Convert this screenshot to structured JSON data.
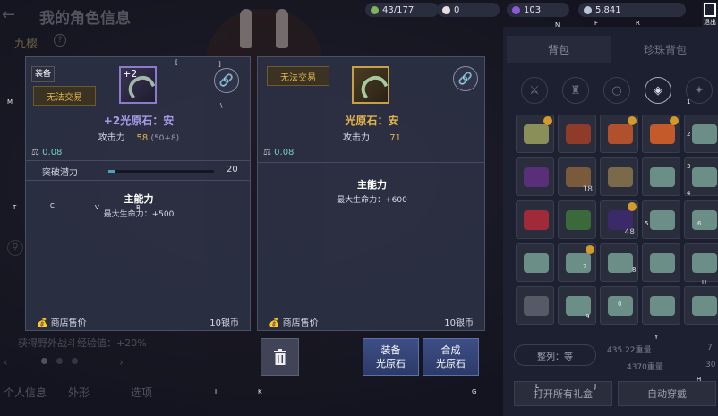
{
  "header": {
    "title": "我的角色信息",
    "char_name": "九樱"
  },
  "resources": [
    {
      "icon": "stamina-icon",
      "value": "43/177",
      "color": "#7fb25a"
    },
    {
      "icon": "pearl-icon",
      "value": "0",
      "color": "#e8dede"
    },
    {
      "icon": "gem-icon",
      "value": "103",
      "color": "#8a5cd6"
    },
    {
      "icon": "silver-coin-icon",
      "value": "5,841",
      "color": "#b9c6d8"
    }
  ],
  "exit_label": "退出",
  "left_bg": {
    "exp_text": "获得野外战斗经验值：+20%",
    "bottom_tabs": [
      "个人信息",
      "外形",
      "选项"
    ]
  },
  "inventory": {
    "tabs": [
      "背包",
      "珍珠背包"
    ],
    "sort_label": "整列：等",
    "weight1": "435.22重量",
    "weight2": "4370重量",
    "cut_value1": "7",
    "cut_value2": "30",
    "open_all_label": "打开所有礼盒",
    "auto_equip_label": "自动穿戴",
    "counts": [
      "18",
      "48"
    ]
  },
  "equipped_card": {
    "equipped_tag": "装备",
    "untradable": "无法交易",
    "enhance_level": "+2",
    "item_name": "+2光原石：安",
    "stat_label": "攻击力",
    "stat_value": "58",
    "stat_detail": "(50+8)",
    "weight": "0.08",
    "potential_label": "突破潜力",
    "potential_value": "20",
    "potential_fill": 0.07,
    "main_label": "主能力",
    "main_value": "最大生命力：+500",
    "sell_label": "商店售价",
    "sell_value": "10银币"
  },
  "compare_card": {
    "untradable": "无法交易",
    "item_name": "光原石：安",
    "stat_label": "攻击力",
    "stat_value": "71",
    "weight": "0.08",
    "main_label": "主能力",
    "main_value": "最大生命力：+600",
    "sell_label": "商店售价",
    "sell_value": "10银币",
    "equip_btn": [
      "装备",
      "光原石"
    ],
    "combine_btn": [
      "合成",
      "光原石"
    ]
  },
  "colors": {
    "accent_purple": "#9b8ee8",
    "accent_gold": "#e3b34c",
    "weight_teal": "#6fd1c6"
  },
  "keyhints": [
    "M",
    "[",
    "]",
    "\\",
    "1",
    "2",
    "3",
    "4",
    "5",
    "6",
    "7",
    "8",
    "9",
    "0",
    "Y",
    "U",
    "H",
    "L",
    "J",
    "I",
    "K",
    "G",
    "N",
    "F",
    "R",
    "T",
    "C",
    "V",
    "B",
    "Num1",
    "Num2",
    "Num3",
    "Num4"
  ]
}
